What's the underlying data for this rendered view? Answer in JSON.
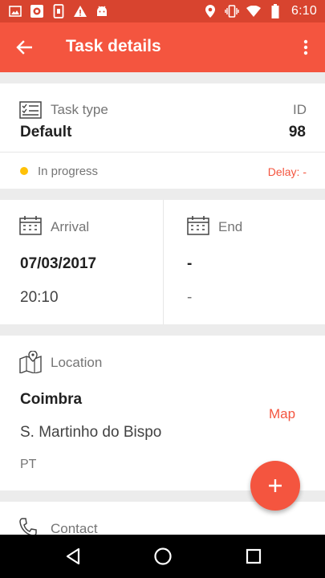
{
  "status_bar": {
    "time": "6:10",
    "left_icons": [
      "image-icon",
      "app-icon",
      "sim-icon",
      "warning-icon",
      "android-icon"
    ],
    "right_icons": [
      "location-icon",
      "vibrate-icon",
      "wifi-icon",
      "battery-icon"
    ]
  },
  "app_bar": {
    "title": "Task details",
    "back_icon": "arrow-back-icon",
    "menu_icon": "more-vert-icon"
  },
  "task": {
    "type_label": "Task type",
    "type_value": "Default",
    "id_label": "ID",
    "id_value": "98",
    "status_text": "In progress",
    "delay_text": "Delay: -"
  },
  "schedule": {
    "arrival_label": "Arrival",
    "arrival_date": "07/03/2017",
    "arrival_time": "20:10",
    "end_label": "End",
    "end_date": "-",
    "end_time": "-"
  },
  "location": {
    "label": "Location",
    "city": "Coimbra",
    "address": "S. Martinho do Bispo",
    "country": "PT",
    "map_link": "Map"
  },
  "contact": {
    "label": "Contact"
  },
  "colors": {
    "primary": "#f4553f",
    "status_bar": "#d8442f",
    "in_progress_dot": "#ffc107"
  }
}
